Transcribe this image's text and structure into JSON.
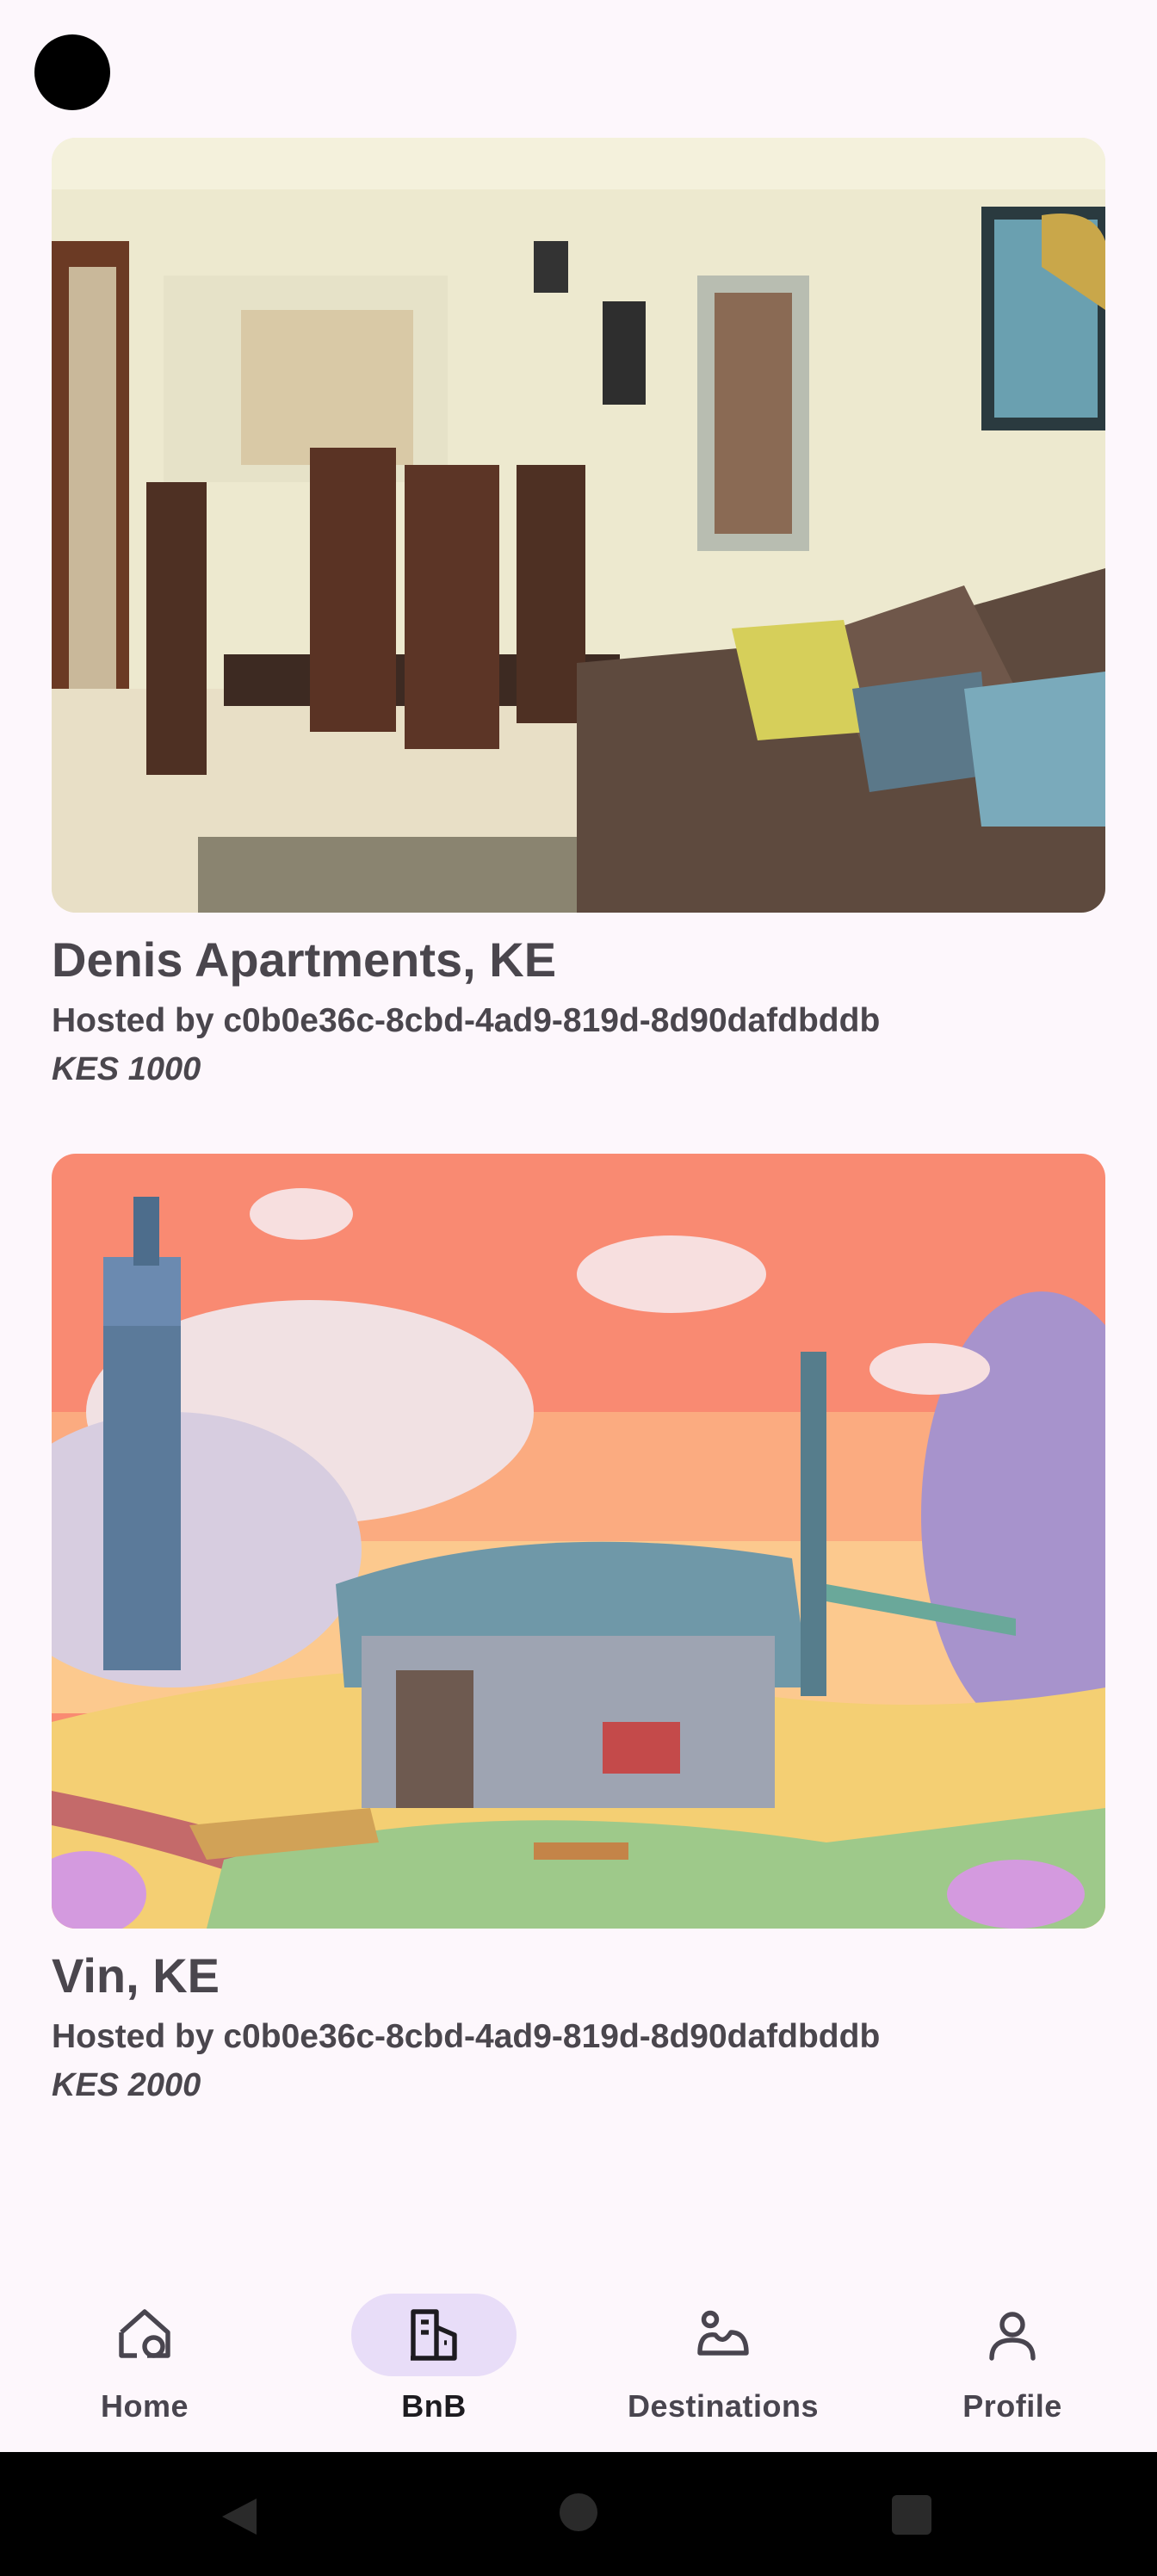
{
  "listings": [
    {
      "title": "Denis Apartments, KE",
      "host": "Hosted by c0b0e36c-8cbd-4ad9-819d-8d90dafdbddb",
      "price": "KES 1000",
      "image": "apartment-interior-photo"
    },
    {
      "title": "Vin, KE",
      "host": "Hosted by c0b0e36c-8cbd-4ad9-819d-8d90dafdbddb",
      "price": "KES 2000",
      "image": "cartoon-cottage-illustration"
    }
  ],
  "bottom_nav": {
    "items": [
      {
        "label": "Home",
        "icon": "home-icon",
        "active": false
      },
      {
        "label": "BnB",
        "icon": "building-icon",
        "active": true
      },
      {
        "label": "Destinations",
        "icon": "landscape-icon",
        "active": false
      },
      {
        "label": "Profile",
        "icon": "person-icon",
        "active": false
      }
    ]
  },
  "colors": {
    "background": "#fdf7fc",
    "active_indicator": "#e8ddf8",
    "text": "#49454f"
  }
}
